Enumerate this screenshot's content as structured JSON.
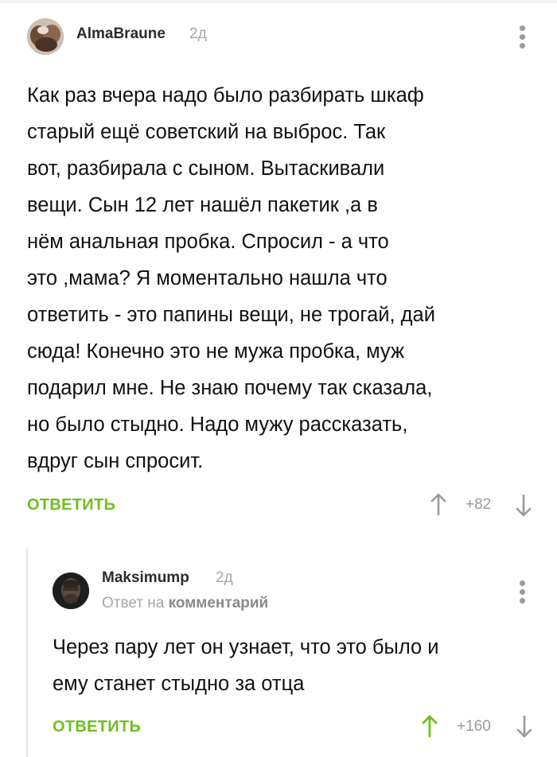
{
  "comments": [
    {
      "author": "AlmaBraune",
      "time": "2д",
      "text": "Как раз вчера надо было разбирать шкаф\nстарый ещё советский на выброс. Так\nвот, разбирала с сыном. Вытаскивали\nвещи. Сын 12 лет нашёл пакетик ,а в\nнём анальная пробка. Спросил - а что\nэто ,мама? Я моментально нашла что\nответить - это папины вещи, не трогай, дай\nсюда! Конечно это не мужа пробка, муж\nподарил мне. Не знаю почему так сказала,\nно было стыдно. Надо мужу рассказать,\nвдруг сын спросит.",
      "reply_label": "ОТВЕТИТЬ",
      "score": "+82",
      "voted": "none"
    },
    {
      "author": "Maksimump",
      "time": "2д",
      "reply_to_prefix": "Ответ на",
      "reply_to_target": "комментарий",
      "text": "Через пару лет он узнает, что это было и\nему станет стыдно за отца",
      "reply_label": "ОТВЕТИТЬ",
      "score": "+160",
      "voted": "up"
    }
  ],
  "colors": {
    "accent": "#6fbf1f",
    "muted": "#a5a5a5",
    "icon": "#9a9a9a",
    "text": "#111111"
  },
  "icons": {
    "menu": "more-vertical-icon",
    "upvote": "arrow-up-icon",
    "downvote": "arrow-down-icon"
  }
}
